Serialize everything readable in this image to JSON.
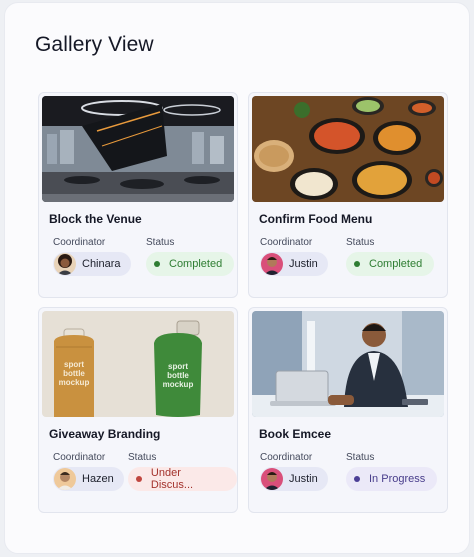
{
  "page": {
    "title": "Gallery View"
  },
  "labels": {
    "coordinator": "Coordinator",
    "status": "Status"
  },
  "cards": [
    {
      "title": "Block the Venue",
      "coordinator": "Chinara",
      "status": "Completed",
      "status_color": "#2e7d32",
      "image": "modern-venue-hall"
    },
    {
      "title": "Confirm Food Menu",
      "coordinator": "Justin",
      "status": "Completed",
      "status_color": "#2e7d32",
      "image": "food-dishes"
    },
    {
      "title": "Giveaway Branding",
      "coordinator": "Hazen",
      "status": "Under Discus...",
      "status_color": "#a3322c",
      "image": "sport-bottles",
      "image_text": [
        "sport",
        "bottle",
        "mockup"
      ]
    },
    {
      "title": "Book Emcee",
      "coordinator": "Justin",
      "status": "In Progress",
      "status_color": "#483d8b",
      "image": "man-at-laptop"
    }
  ]
}
